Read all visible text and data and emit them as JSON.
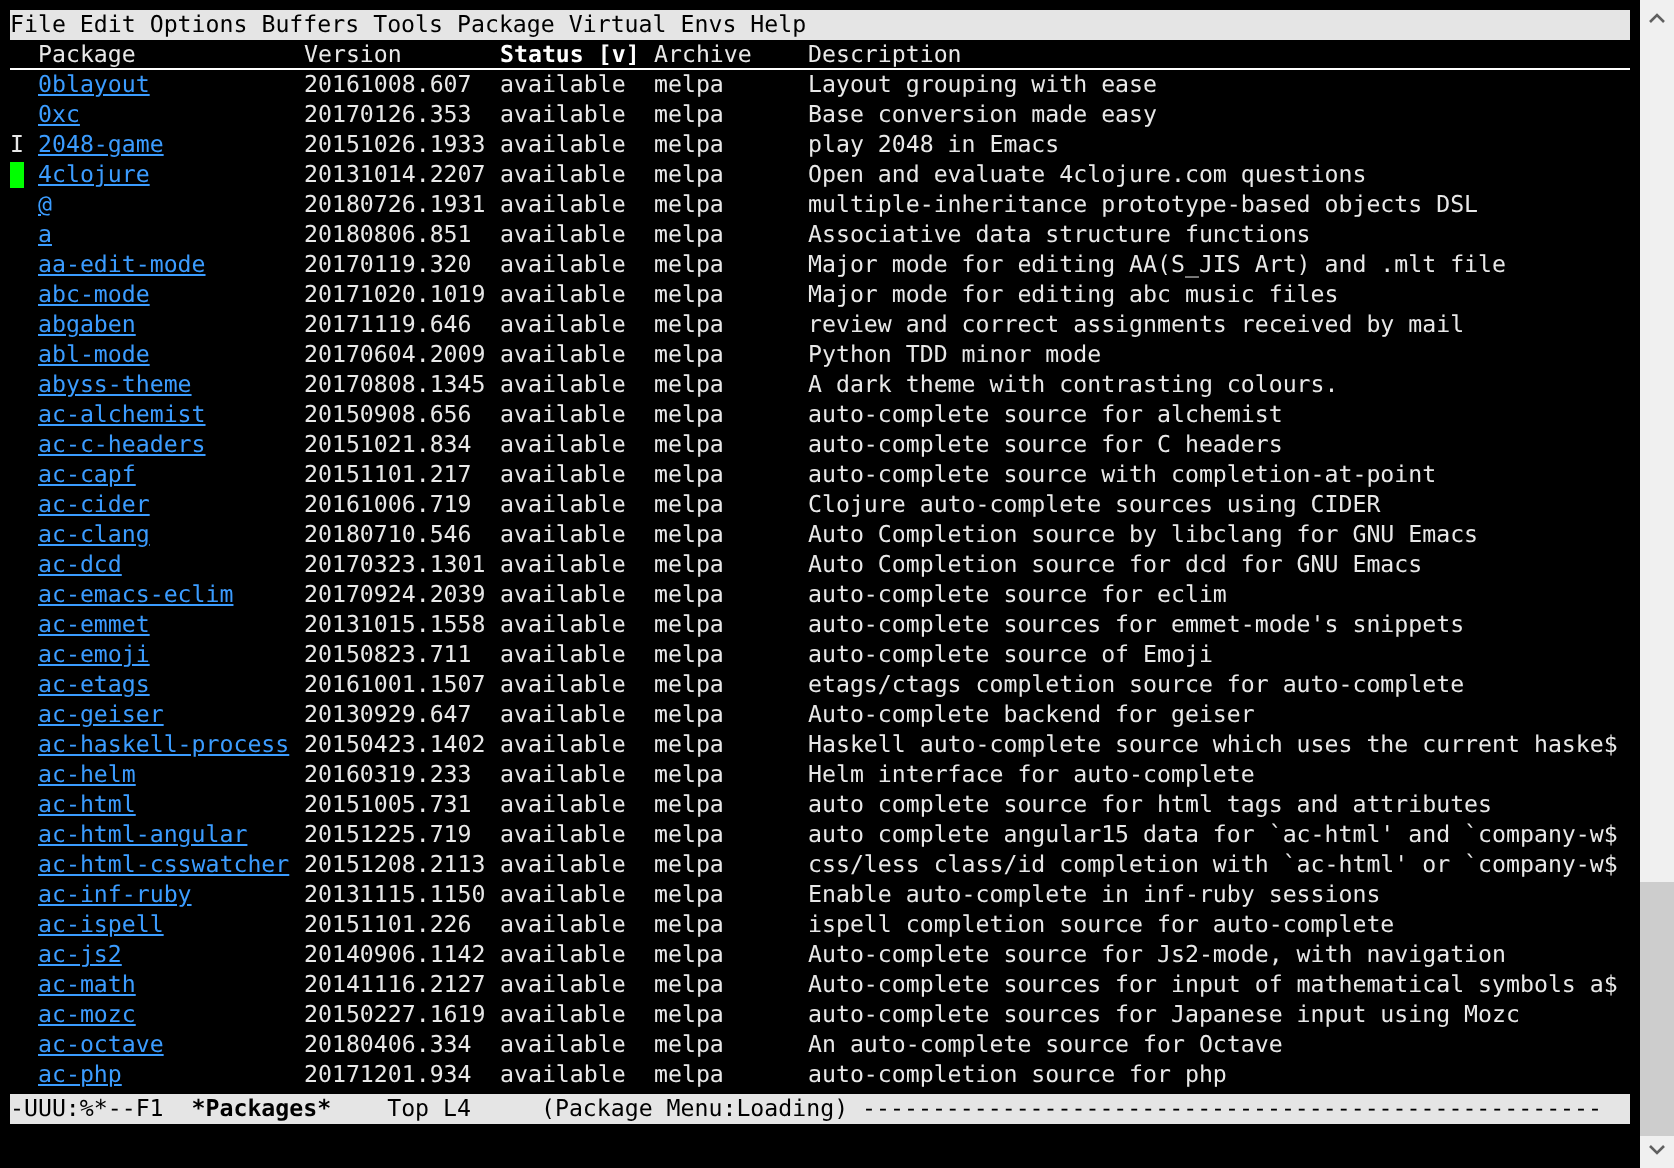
{
  "menu_bar": [
    "File",
    "Edit",
    "Options",
    "Buffers",
    "Tools",
    "Package",
    "Virtual",
    "Envs",
    "Help"
  ],
  "table": {
    "columns": [
      {
        "label": "Package",
        "sorted": false
      },
      {
        "label": "Version",
        "sorted": false
      },
      {
        "label": "Status [v]",
        "sorted": true
      },
      {
        "label": "Archive",
        "sorted": false
      },
      {
        "label": "Description",
        "sorted": false
      }
    ],
    "rows": [
      {
        "mark": "",
        "cursor": false,
        "package": "0blayout",
        "version": "20161008.607",
        "status": "available",
        "archive": "melpa",
        "description": "Layout grouping with ease"
      },
      {
        "mark": "",
        "cursor": false,
        "package": "0xc",
        "version": "20170126.353",
        "status": "available",
        "archive": "melpa",
        "description": "Base conversion made easy"
      },
      {
        "mark": "I",
        "cursor": false,
        "package": "2048-game",
        "version": "20151026.1933",
        "status": "available",
        "archive": "melpa",
        "description": "play 2048 in Emacs"
      },
      {
        "mark": "",
        "cursor": true,
        "package": "4clojure",
        "version": "20131014.2207",
        "status": "available",
        "archive": "melpa",
        "description": "Open and evaluate 4clojure.com questions"
      },
      {
        "mark": "",
        "cursor": false,
        "package": "@",
        "version": "20180726.1931",
        "status": "available",
        "archive": "melpa",
        "description": "multiple-inheritance prototype-based objects DSL"
      },
      {
        "mark": "",
        "cursor": false,
        "package": "a",
        "version": "20180806.851",
        "status": "available",
        "archive": "melpa",
        "description": "Associative data structure functions"
      },
      {
        "mark": "",
        "cursor": false,
        "package": "aa-edit-mode",
        "version": "20170119.320",
        "status": "available",
        "archive": "melpa",
        "description": "Major mode for editing AA(S_JIS Art) and .mlt file"
      },
      {
        "mark": "",
        "cursor": false,
        "package": "abc-mode",
        "version": "20171020.1019",
        "status": "available",
        "archive": "melpa",
        "description": "Major mode for editing abc music files"
      },
      {
        "mark": "",
        "cursor": false,
        "package": "abgaben",
        "version": "20171119.646",
        "status": "available",
        "archive": "melpa",
        "description": "review and correct assignments received by mail"
      },
      {
        "mark": "",
        "cursor": false,
        "package": "abl-mode",
        "version": "20170604.2009",
        "status": "available",
        "archive": "melpa",
        "description": "Python TDD minor mode"
      },
      {
        "mark": "",
        "cursor": false,
        "package": "abyss-theme",
        "version": "20170808.1345",
        "status": "available",
        "archive": "melpa",
        "description": "A dark theme with contrasting colours."
      },
      {
        "mark": "",
        "cursor": false,
        "package": "ac-alchemist",
        "version": "20150908.656",
        "status": "available",
        "archive": "melpa",
        "description": "auto-complete source for alchemist"
      },
      {
        "mark": "",
        "cursor": false,
        "package": "ac-c-headers",
        "version": "20151021.834",
        "status": "available",
        "archive": "melpa",
        "description": "auto-complete source for C headers"
      },
      {
        "mark": "",
        "cursor": false,
        "package": "ac-capf",
        "version": "20151101.217",
        "status": "available",
        "archive": "melpa",
        "description": "auto-complete source with completion-at-point"
      },
      {
        "mark": "",
        "cursor": false,
        "package": "ac-cider",
        "version": "20161006.719",
        "status": "available",
        "archive": "melpa",
        "description": "Clojure auto-complete sources using CIDER"
      },
      {
        "mark": "",
        "cursor": false,
        "package": "ac-clang",
        "version": "20180710.546",
        "status": "available",
        "archive": "melpa",
        "description": "Auto Completion source by libclang for GNU Emacs"
      },
      {
        "mark": "",
        "cursor": false,
        "package": "ac-dcd",
        "version": "20170323.1301",
        "status": "available",
        "archive": "melpa",
        "description": "Auto Completion source for dcd for GNU Emacs"
      },
      {
        "mark": "",
        "cursor": false,
        "package": "ac-emacs-eclim",
        "version": "20170924.2039",
        "status": "available",
        "archive": "melpa",
        "description": "auto-complete source for eclim"
      },
      {
        "mark": "",
        "cursor": false,
        "package": "ac-emmet",
        "version": "20131015.1558",
        "status": "available",
        "archive": "melpa",
        "description": "auto-complete sources for emmet-mode's snippets"
      },
      {
        "mark": "",
        "cursor": false,
        "package": "ac-emoji",
        "version": "20150823.711",
        "status": "available",
        "archive": "melpa",
        "description": "auto-complete source of Emoji"
      },
      {
        "mark": "",
        "cursor": false,
        "package": "ac-etags",
        "version": "20161001.1507",
        "status": "available",
        "archive": "melpa",
        "description": "etags/ctags completion source for auto-complete"
      },
      {
        "mark": "",
        "cursor": false,
        "package": "ac-geiser",
        "version": "20130929.647",
        "status": "available",
        "archive": "melpa",
        "description": "Auto-complete backend for geiser"
      },
      {
        "mark": "",
        "cursor": false,
        "package": "ac-haskell-process",
        "version": "20150423.1402",
        "status": "available",
        "archive": "melpa",
        "description": "Haskell auto-complete source which uses the current haske$"
      },
      {
        "mark": "",
        "cursor": false,
        "package": "ac-helm",
        "version": "20160319.233",
        "status": "available",
        "archive": "melpa",
        "description": "Helm interface for auto-complete"
      },
      {
        "mark": "",
        "cursor": false,
        "package": "ac-html",
        "version": "20151005.731",
        "status": "available",
        "archive": "melpa",
        "description": "auto complete source for html tags and attributes"
      },
      {
        "mark": "",
        "cursor": false,
        "package": "ac-html-angular",
        "version": "20151225.719",
        "status": "available",
        "archive": "melpa",
        "description": "auto complete angular15 data for `ac-html' and `company-w$"
      },
      {
        "mark": "",
        "cursor": false,
        "package": "ac-html-csswatcher",
        "version": "20151208.2113",
        "status": "available",
        "archive": "melpa",
        "description": "css/less class/id completion with `ac-html' or `company-w$"
      },
      {
        "mark": "",
        "cursor": false,
        "package": "ac-inf-ruby",
        "version": "20131115.1150",
        "status": "available",
        "archive": "melpa",
        "description": "Enable auto-complete in inf-ruby sessions"
      },
      {
        "mark": "",
        "cursor": false,
        "package": "ac-ispell",
        "version": "20151101.226",
        "status": "available",
        "archive": "melpa",
        "description": "ispell completion source for auto-complete"
      },
      {
        "mark": "",
        "cursor": false,
        "package": "ac-js2",
        "version": "20140906.1142",
        "status": "available",
        "archive": "melpa",
        "description": "Auto-complete source for Js2-mode, with navigation"
      },
      {
        "mark": "",
        "cursor": false,
        "package": "ac-math",
        "version": "20141116.2127",
        "status": "available",
        "archive": "melpa",
        "description": "Auto-complete sources for input of mathematical symbols a$"
      },
      {
        "mark": "",
        "cursor": false,
        "package": "ac-mozc",
        "version": "20150227.1619",
        "status": "available",
        "archive": "melpa",
        "description": "auto-complete sources for Japanese input using Mozc"
      },
      {
        "mark": "",
        "cursor": false,
        "package": "ac-octave",
        "version": "20180406.334",
        "status": "available",
        "archive": "melpa",
        "description": "An auto-complete source for Octave"
      },
      {
        "mark": "",
        "cursor": false,
        "package": "ac-php",
        "version": "20171201.934",
        "status": "available",
        "archive": "melpa",
        "description": "auto-completion source for php"
      }
    ]
  },
  "mode_line": {
    "state": "-UUU:%*--F1",
    "buffer": "*Packages*",
    "position": "Top L4",
    "mode": "(Package Menu:Loading)",
    "fill": "-----------------------------------------------------"
  }
}
